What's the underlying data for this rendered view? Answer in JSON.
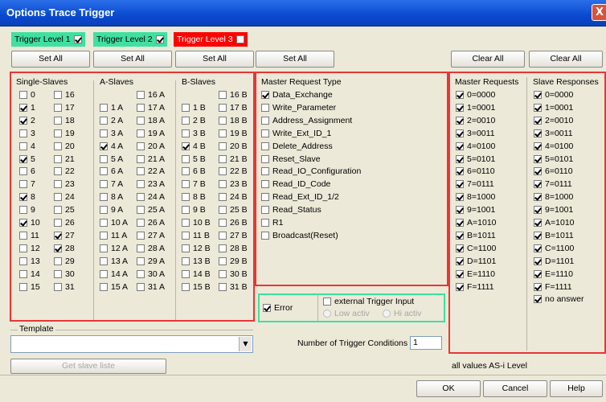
{
  "window": {
    "title": "Options Trace Trigger",
    "close_glyph": "X"
  },
  "levels": [
    {
      "label": "Trigger Level 1",
      "checked": true,
      "bg": "#3fe0a0"
    },
    {
      "label": "Trigger Level 2",
      "checked": true,
      "bg": "#3fe0a0"
    },
    {
      "label": "Trigger Level 3",
      "checked": false,
      "bg": "#ff0000"
    }
  ],
  "top_buttons": {
    "set_all": "Set All",
    "clear_all": "Clear All"
  },
  "single": {
    "header": "Single-Slaves",
    "col1": [
      {
        "l": "0",
        "c": false
      },
      {
        "l": "1",
        "c": true
      },
      {
        "l": "2",
        "c": true
      },
      {
        "l": "3",
        "c": false
      },
      {
        "l": "4",
        "c": false
      },
      {
        "l": "5",
        "c": true
      },
      {
        "l": "6",
        "c": false
      },
      {
        "l": "7",
        "c": false
      },
      {
        "l": "8",
        "c": true
      },
      {
        "l": "9",
        "c": false
      },
      {
        "l": "10",
        "c": true
      },
      {
        "l": "11",
        "c": false
      },
      {
        "l": "12",
        "c": false
      },
      {
        "l": "13",
        "c": false
      },
      {
        "l": "14",
        "c": false
      },
      {
        "l": "15",
        "c": false
      }
    ],
    "col2": [
      {
        "l": "16",
        "c": false
      },
      {
        "l": "17",
        "c": false
      },
      {
        "l": "18",
        "c": false
      },
      {
        "l": "19",
        "c": false
      },
      {
        "l": "20",
        "c": false
      },
      {
        "l": "21",
        "c": false
      },
      {
        "l": "22",
        "c": false
      },
      {
        "l": "23",
        "c": false
      },
      {
        "l": "24",
        "c": false
      },
      {
        "l": "25",
        "c": false
      },
      {
        "l": "26",
        "c": false
      },
      {
        "l": "27",
        "c": true
      },
      {
        "l": "28",
        "c": true
      },
      {
        "l": "29",
        "c": false
      },
      {
        "l": "30",
        "c": false
      },
      {
        "l": "31",
        "c": false
      }
    ]
  },
  "aslaves": {
    "header": "A-Slaves",
    "col1": [
      {
        "l": "",
        "c": false
      },
      {
        "l": "1 A",
        "c": false
      },
      {
        "l": "2 A",
        "c": false
      },
      {
        "l": "3 A",
        "c": false
      },
      {
        "l": "4 A",
        "c": true
      },
      {
        "l": "5 A",
        "c": false
      },
      {
        "l": "6 A",
        "c": false
      },
      {
        "l": "7 A",
        "c": false
      },
      {
        "l": "8 A",
        "c": false
      },
      {
        "l": "9 A",
        "c": false
      },
      {
        "l": "10 A",
        "c": false
      },
      {
        "l": "11 A",
        "c": false
      },
      {
        "l": "12 A",
        "c": false
      },
      {
        "l": "13 A",
        "c": false
      },
      {
        "l": "14 A",
        "c": false
      },
      {
        "l": "15 A",
        "c": false
      }
    ],
    "col2": [
      {
        "l": "16 A",
        "c": false
      },
      {
        "l": "17 A",
        "c": false
      },
      {
        "l": "18 A",
        "c": false
      },
      {
        "l": "19 A",
        "c": false
      },
      {
        "l": "20 A",
        "c": false
      },
      {
        "l": "21 A",
        "c": false
      },
      {
        "l": "22 A",
        "c": false
      },
      {
        "l": "23 A",
        "c": false
      },
      {
        "l": "24 A",
        "c": false
      },
      {
        "l": "25 A",
        "c": false
      },
      {
        "l": "26 A",
        "c": false
      },
      {
        "l": "27 A",
        "c": false
      },
      {
        "l": "28 A",
        "c": false
      },
      {
        "l": "29 A",
        "c": false
      },
      {
        "l": "30 A",
        "c": false
      },
      {
        "l": "31 A",
        "c": false
      }
    ]
  },
  "bslaves": {
    "header": "B-Slaves",
    "col1": [
      {
        "l": "",
        "c": false
      },
      {
        "l": "1 B",
        "c": false
      },
      {
        "l": "2 B",
        "c": false
      },
      {
        "l": "3 B",
        "c": false
      },
      {
        "l": "4 B",
        "c": true
      },
      {
        "l": "5 B",
        "c": false
      },
      {
        "l": "6 B",
        "c": false
      },
      {
        "l": "7 B",
        "c": false
      },
      {
        "l": "8 B",
        "c": false
      },
      {
        "l": "9 B",
        "c": false
      },
      {
        "l": "10 B",
        "c": false
      },
      {
        "l": "11 B",
        "c": false
      },
      {
        "l": "12 B",
        "c": false
      },
      {
        "l": "13 B",
        "c": false
      },
      {
        "l": "14 B",
        "c": false
      },
      {
        "l": "15 B",
        "c": false
      }
    ],
    "col2": [
      {
        "l": "16 B",
        "c": false
      },
      {
        "l": "17 B",
        "c": false
      },
      {
        "l": "18 B",
        "c": false
      },
      {
        "l": "19 B",
        "c": false
      },
      {
        "l": "20 B",
        "c": false
      },
      {
        "l": "21 B",
        "c": false
      },
      {
        "l": "22 B",
        "c": false
      },
      {
        "l": "23 B",
        "c": false
      },
      {
        "l": "24 B",
        "c": false
      },
      {
        "l": "25 B",
        "c": false
      },
      {
        "l": "26 B",
        "c": false
      },
      {
        "l": "27 B",
        "c": false
      },
      {
        "l": "28 B",
        "c": false
      },
      {
        "l": "29 B",
        "c": false
      },
      {
        "l": "30 B",
        "c": false
      },
      {
        "l": "31 B",
        "c": false
      }
    ]
  },
  "master_type": {
    "header": "Master Request Type",
    "items": [
      {
        "l": "Data_Exchange",
        "c": true
      },
      {
        "l": "Write_Parameter",
        "c": false
      },
      {
        "l": "Address_Assignment",
        "c": false
      },
      {
        "l": "Write_Ext_ID_1",
        "c": false
      },
      {
        "l": "Delete_Address",
        "c": false
      },
      {
        "l": "Reset_Slave",
        "c": false
      },
      {
        "l": "Read_IO_Configuration",
        "c": false
      },
      {
        "l": "Read_ID_Code",
        "c": false
      },
      {
        "l": "Read_Ext_ID_1/2",
        "c": false
      },
      {
        "l": "Read_Status",
        "c": false
      },
      {
        "l": "R1",
        "c": false
      },
      {
        "l": "Broadcast(Reset)",
        "c": false
      }
    ]
  },
  "error": {
    "label": "Error",
    "checked": true
  },
  "ext_trigger": {
    "label": "external Trigger Input",
    "checked": false,
    "low": "Low activ",
    "hi": "Hi activ"
  },
  "master_req": {
    "header": "Master Requests",
    "items": [
      {
        "l": "0=0000",
        "c": true
      },
      {
        "l": "1=0001",
        "c": true
      },
      {
        "l": "2=0010",
        "c": true
      },
      {
        "l": "3=0011",
        "c": true
      },
      {
        "l": "4=0100",
        "c": true
      },
      {
        "l": "5=0101",
        "c": true
      },
      {
        "l": "6=0110",
        "c": true
      },
      {
        "l": "7=0111",
        "c": true
      },
      {
        "l": "8=1000",
        "c": true
      },
      {
        "l": "9=1001",
        "c": true
      },
      {
        "l": "A=1010",
        "c": true
      },
      {
        "l": "B=1011",
        "c": true
      },
      {
        "l": "C=1100",
        "c": true
      },
      {
        "l": "D=1101",
        "c": true
      },
      {
        "l": "E=1110",
        "c": true
      },
      {
        "l": "F=1111",
        "c": true
      }
    ]
  },
  "slave_resp": {
    "header": "Slave Responses",
    "items": [
      {
        "l": "0=0000",
        "c": true
      },
      {
        "l": "1=0001",
        "c": true
      },
      {
        "l": "2=0010",
        "c": true
      },
      {
        "l": "3=0011",
        "c": true
      },
      {
        "l": "4=0100",
        "c": true
      },
      {
        "l": "5=0101",
        "c": true
      },
      {
        "l": "6=0110",
        "c": true
      },
      {
        "l": "7=0111",
        "c": true
      },
      {
        "l": "8=1000",
        "c": true
      },
      {
        "l": "9=1001",
        "c": true
      },
      {
        "l": "A=1010",
        "c": true
      },
      {
        "l": "B=1011",
        "c": true
      },
      {
        "l": "C=1100",
        "c": true
      },
      {
        "l": "D=1101",
        "c": true
      },
      {
        "l": "E=1110",
        "c": true
      },
      {
        "l": "F=1111",
        "c": true
      },
      {
        "l": "no answer",
        "c": true
      }
    ]
  },
  "template": {
    "label": "Template",
    "value": "",
    "arrow": "▼"
  },
  "get_slave": "Get slave liste",
  "num_conditions": {
    "label": "Number of Trigger Conditions",
    "value": "1"
  },
  "as_i_note": "all values AS-i Level",
  "footer": {
    "ok": "OK",
    "cancel": "Cancel",
    "help": "Help"
  }
}
